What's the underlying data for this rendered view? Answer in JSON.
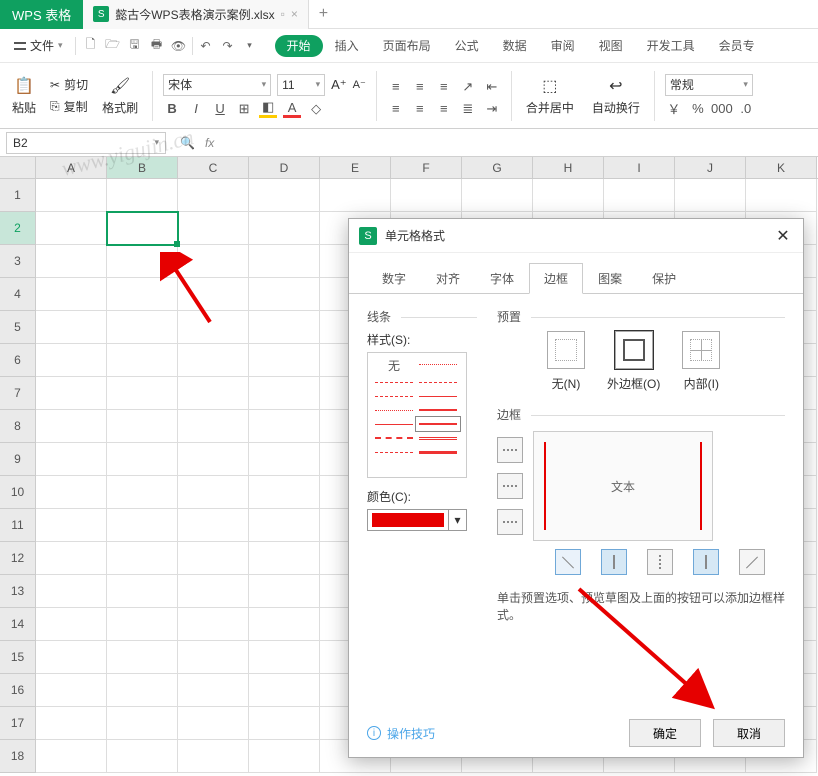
{
  "app": {
    "name": "WPS 表格",
    "tab_file": "懿古今WPS表格演示案例.xlsx",
    "tab_add": "+"
  },
  "menu": {
    "file": "文件",
    "tabs": [
      "开始",
      "插入",
      "页面布局",
      "公式",
      "数据",
      "审阅",
      "视图",
      "开发工具",
      "会员专"
    ],
    "active": 0
  },
  "ribbon": {
    "paste": "粘贴",
    "cut": "剪切",
    "copy": "复制",
    "format_painter": "格式刷",
    "font_name": "宋体",
    "font_size": "11",
    "merge_center": "合并居中",
    "wrap_text": "自动换行",
    "number_format": "常规",
    "currency": "￥",
    "percent": "%"
  },
  "formula": {
    "cell_ref": "B2",
    "fx": "fx"
  },
  "grid": {
    "cols": [
      "A",
      "B",
      "C",
      "D",
      "E",
      "F",
      "G",
      "H",
      "I",
      "J",
      "K"
    ],
    "rows": [
      "1",
      "2",
      "3",
      "4",
      "5",
      "6",
      "7",
      "8",
      "9",
      "10",
      "11",
      "12",
      "13",
      "14",
      "15",
      "16",
      "17",
      "18"
    ],
    "sel_col": 1,
    "sel_row": 1
  },
  "dialog": {
    "title": "单元格格式",
    "tabs": [
      "数字",
      "对齐",
      "字体",
      "边框",
      "图案",
      "保护"
    ],
    "active_tab": 3,
    "line_section": "线条",
    "style_label": "样式(S):",
    "style_none": "无",
    "color_label": "颜色(C):",
    "preset_section": "预置",
    "preset_none": "无(N)",
    "preset_outer": "外边框(O)",
    "preset_inner": "内部(I)",
    "border_section": "边框",
    "preview_text": "文本",
    "hint": "单击预置选项、预览草图及上面的按钮可以添加边框样式。",
    "tips": "操作技巧",
    "ok": "确定",
    "cancel": "取消"
  },
  "watermark": "www.yigujin.cn"
}
